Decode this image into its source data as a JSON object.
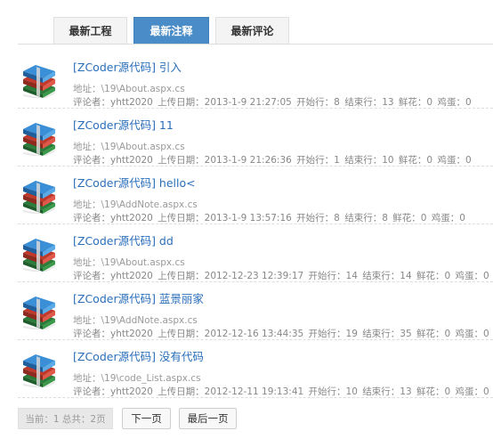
{
  "tabs": [
    {
      "label": "最新工程",
      "active": false
    },
    {
      "label": "最新注释",
      "active": true
    },
    {
      "label": "最新评论",
      "active": false
    }
  ],
  "icon": "rar-archive-books-icon",
  "items": [
    {
      "title": "[ZCoder源代码] 引入",
      "address": "地址：\\19\\About.aspx.cs",
      "commenter": "评论者：yhtt2020",
      "upload_date": "上传日期：2013-1-9 21:27:05",
      "start_line": "开始行：8",
      "end_line": "结束行：13",
      "flowers": "鲜花：0",
      "eggs": "鸡蛋：0"
    },
    {
      "title": "[ZCoder源代码] 11",
      "address": "地址：\\19\\About.aspx.cs",
      "commenter": "评论者：yhtt2020",
      "upload_date": "上传日期：2013-1-9 21:26:36",
      "start_line": "开始行：1",
      "end_line": "结束行：10",
      "flowers": "鲜花：0",
      "eggs": "鸡蛋：0"
    },
    {
      "title": "[ZCoder源代码] hello<",
      "address": "地址：\\19\\AddNote.aspx.cs",
      "commenter": "评论者：yhtt2020",
      "upload_date": "上传日期：2013-1-9 13:57:16",
      "start_line": "开始行：8",
      "end_line": "结束行：8",
      "flowers": "鲜花：0",
      "eggs": "鸡蛋：0"
    },
    {
      "title": "[ZCoder源代码] dd",
      "address": "地址：\\19\\About.aspx.cs",
      "commenter": "评论者：yhtt2020",
      "upload_date": "上传日期：2012-12-23 12:39:17",
      "start_line": "开始行：14",
      "end_line": "结束行：14",
      "flowers": "鲜花：0",
      "eggs": "鸡蛋：0"
    },
    {
      "title": "[ZCoder源代码] 蓝景丽家",
      "address": "地址：\\19\\AddNote.aspx.cs",
      "commenter": "评论者：yhtt2020",
      "upload_date": "上传日期：2012-12-16 13:44:35",
      "start_line": "开始行：19",
      "end_line": "结束行：35",
      "flowers": "鲜花：0",
      "eggs": "鸡蛋：0"
    },
    {
      "title": "[ZCoder源代码] 没有代码",
      "address": "地址：\\19\\code_List.aspx.cs",
      "commenter": "评论者：yhtt2020",
      "upload_date": "上传日期：2012-12-11 19:13:41",
      "start_line": "开始行：10",
      "end_line": "结束行：13",
      "flowers": "鲜花：0",
      "eggs": "鸡蛋：0"
    }
  ],
  "pager": {
    "info": "当前：1 总共：2页",
    "next_label": "下一页",
    "last_label": "最后一页"
  }
}
